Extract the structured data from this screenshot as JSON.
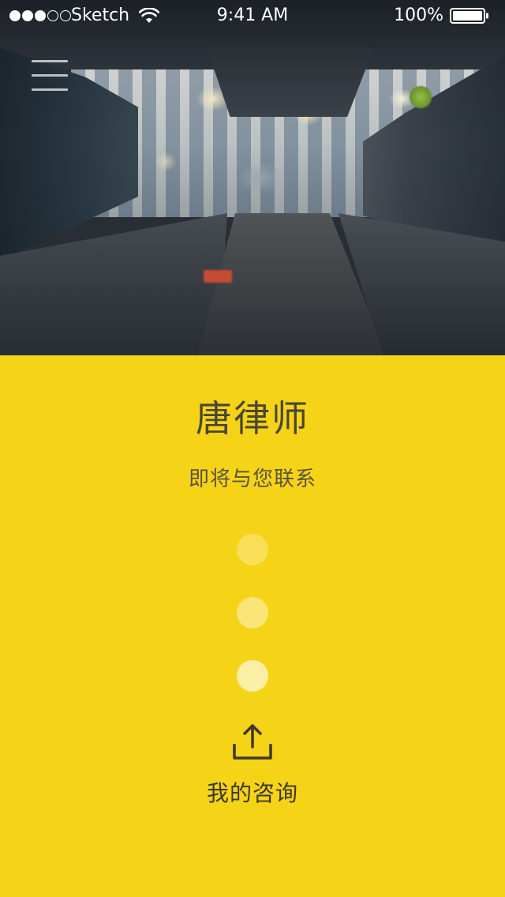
{
  "status_bar": {
    "carrier": "Sketch",
    "time": "9:41 AM",
    "battery": "100%",
    "signal_icon": "signal-dots-icon",
    "wifi_icon": "wifi-icon",
    "battery_icon": "battery-icon"
  },
  "header": {
    "menu_icon": "hamburger-menu-icon"
  },
  "contact": {
    "lawyer_name": "唐律师",
    "message": "即将与您联系"
  },
  "progress": {
    "dot_count": 3
  },
  "action": {
    "icon": "upload-icon",
    "label": "我的咨询"
  },
  "colors": {
    "panel_background": "#F5D317",
    "text_dark": "#4a4535"
  }
}
